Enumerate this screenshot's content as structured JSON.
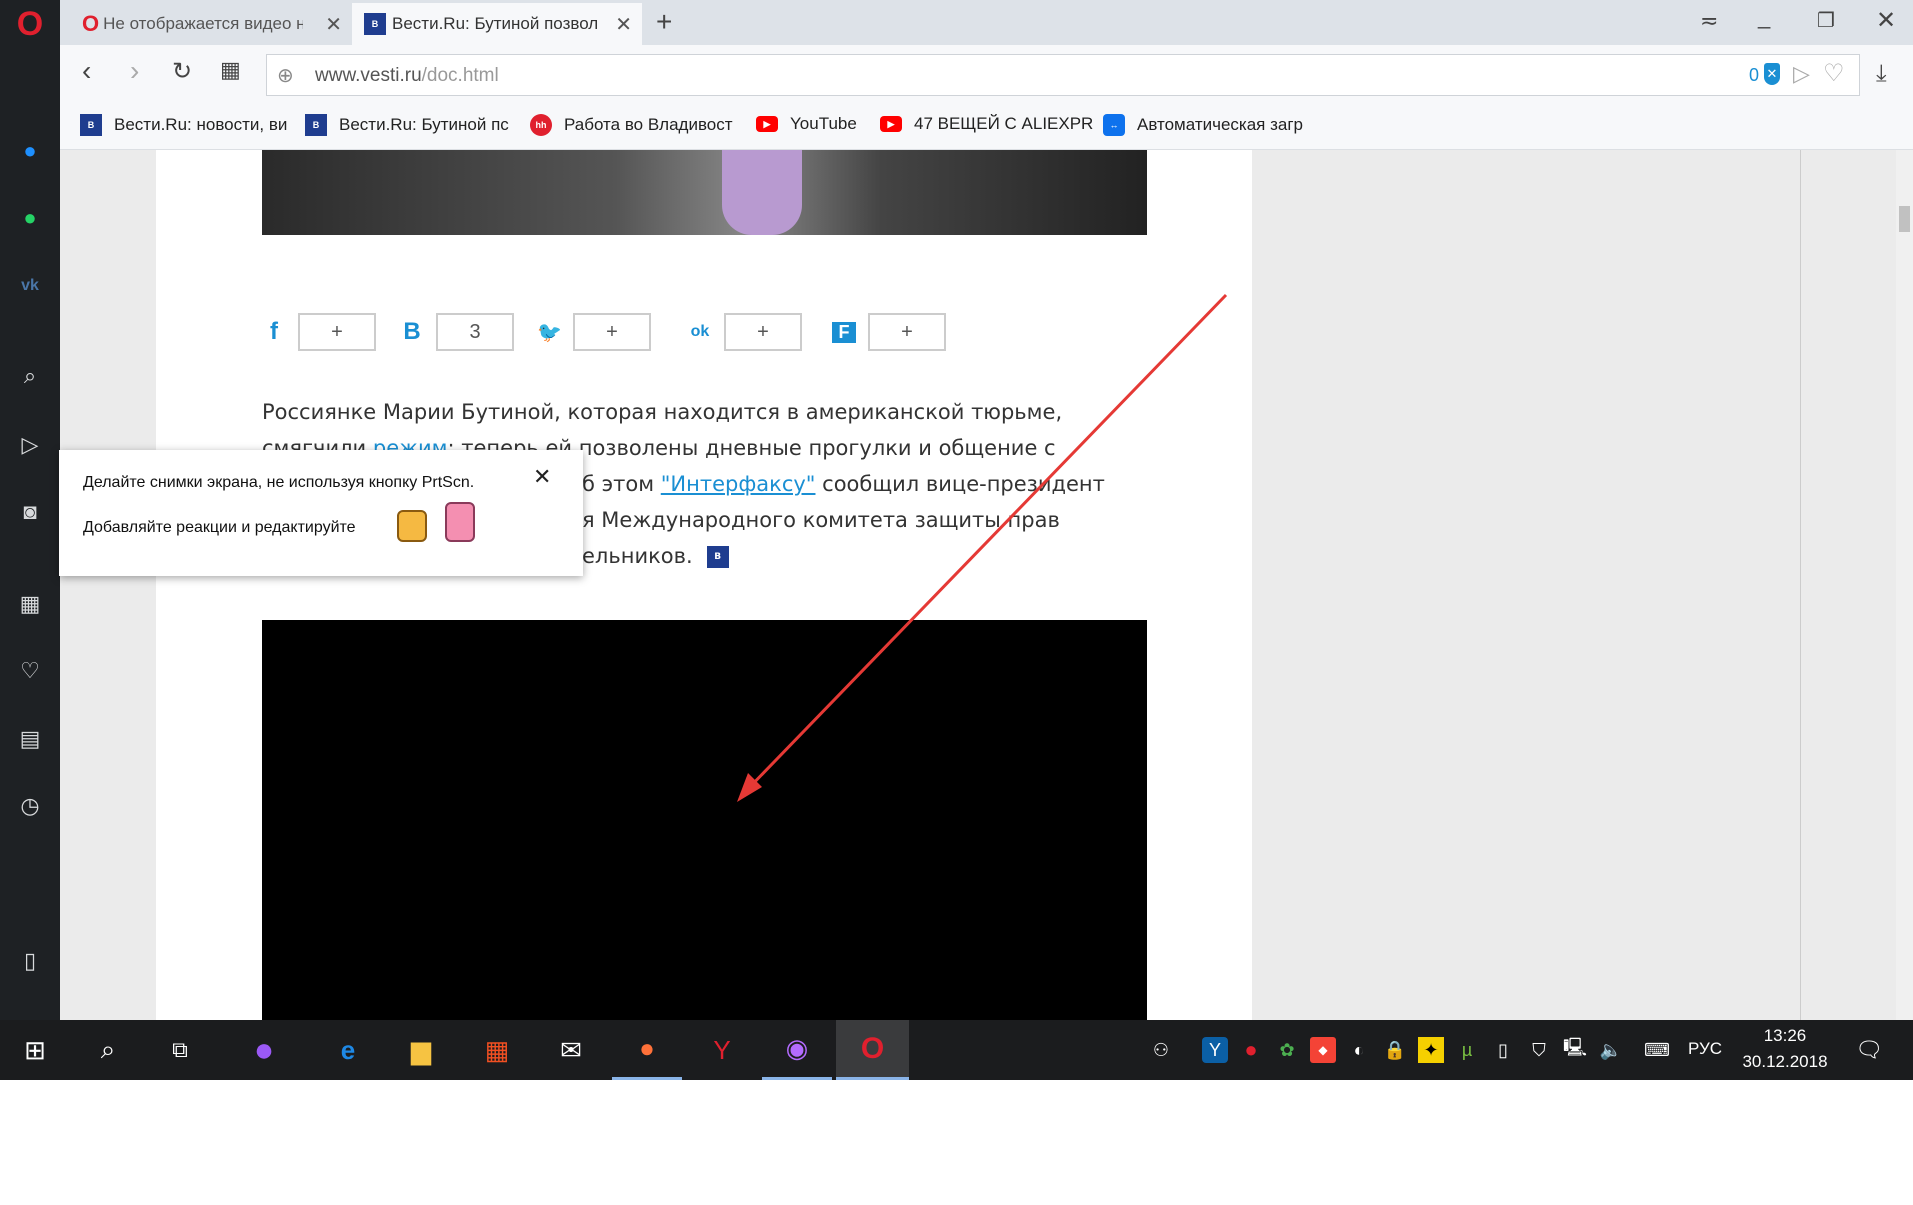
{
  "tabs": [
    {
      "label": "Не отображается видео н",
      "icon": "opera-icon"
    },
    {
      "label": "Вести.Ru: Бутиной позвол",
      "icon": "vesti-icon",
      "active": true
    }
  ],
  "address": {
    "domain": "www.vesti.ru",
    "path": "/doc.html",
    "ad_block_count": "0"
  },
  "bookmarks": [
    {
      "label": "Вести.Ru: новости, ви",
      "icon": "vesti-icon"
    },
    {
      "label": "Вести.Ru: Бутиной пс",
      "icon": "vesti-icon"
    },
    {
      "label": "Работа во Владивост",
      "icon": "hh-icon"
    },
    {
      "label": "YouTube",
      "icon": "youtube-icon"
    },
    {
      "label": "47 ВЕЩЕЙ С ALIEXPR",
      "icon": "youtube-icon"
    },
    {
      "label": "Автоматическая загр",
      "icon": "teamviewer-icon"
    }
  ],
  "share": [
    {
      "network": "facebook",
      "icon": "f",
      "count": "+"
    },
    {
      "network": "vk",
      "icon": "B",
      "count": "3"
    },
    {
      "network": "twitter",
      "icon": "🐦",
      "count": "+"
    },
    {
      "network": "odnoklassniki",
      "icon": "ok",
      "count": "+"
    },
    {
      "network": "flipboard",
      "icon": "F",
      "count": "+"
    }
  ],
  "article": {
    "line1": "Россиянке Марии Бутиной, которая находится в американской тюрьме,",
    "line2_a": "смягчили ",
    "line2_link": "режим",
    "line2_b": ": теперь ей позволены дневные прогулки и общение с",
    "line3_a": "б этом ",
    "line3_link": "\"Интерфаксу\"",
    "line3_b": " сообщил вице-президент",
    "line4": "я Международного комитета защиты прав",
    "line5": "ельников."
  },
  "popup": {
    "line1": "Делайте снимки экрана, не используя кнопку PrtScn.",
    "line2": "Добавляйте реакции и редактируйте"
  },
  "tray": {
    "lang": "РУС",
    "time": "13:26",
    "date": "30.12.2018"
  },
  "colors": {
    "accent": "#1a8fd3",
    "opera": "#e0202e",
    "arrow": "#e53935"
  }
}
